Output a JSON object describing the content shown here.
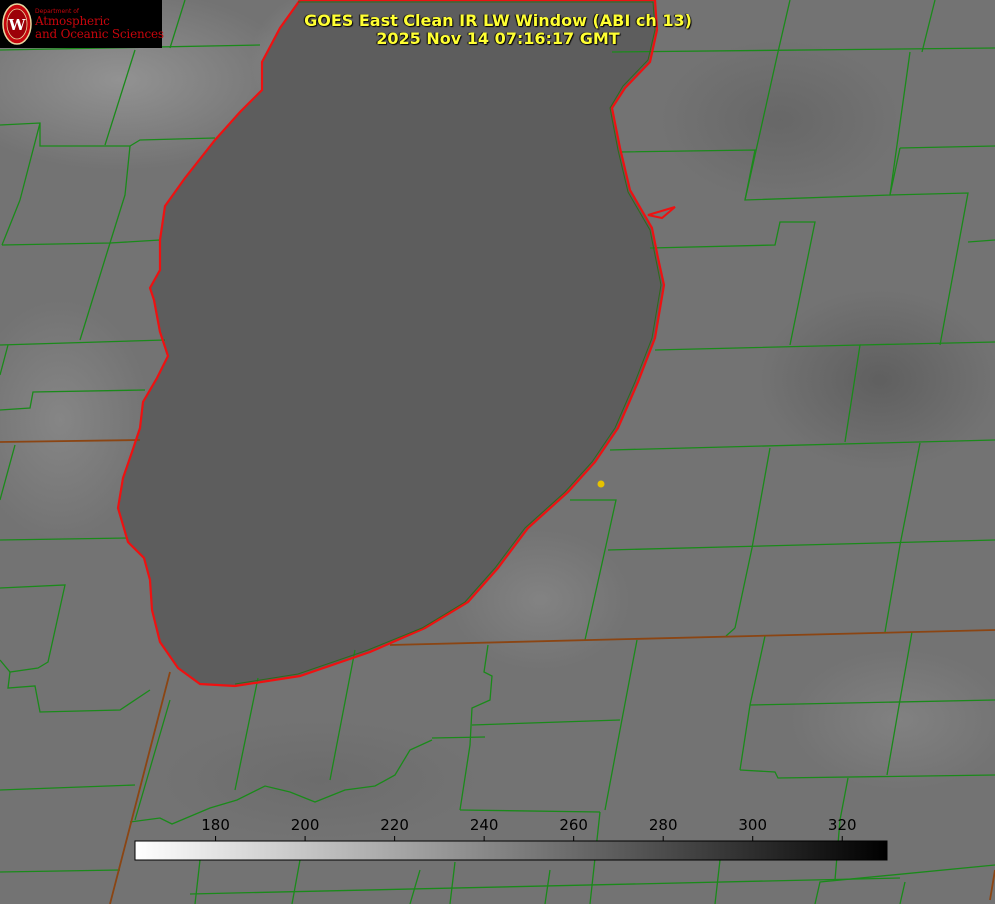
{
  "header": {
    "title": "GOES East Clean IR LW Window (ABI ch 13)",
    "timestamp": "2025 Nov 14 07:16:17 GMT"
  },
  "logo": {
    "department_line": "Department of",
    "name_line1": "Atmospheric",
    "name_line2": "and Oceanic Sciences",
    "seal_letter": "W"
  },
  "colorbar": {
    "ticks": [
      "180",
      "200",
      "220",
      "240",
      "260",
      "280",
      "300",
      "320"
    ],
    "tick_values": [
      180,
      200,
      220,
      240,
      260,
      280,
      300,
      320
    ],
    "range": [
      162,
      330
    ],
    "gradient": "white-to-black"
  },
  "colors": {
    "county_lines": "#1a8a1a",
    "state_lines": "#8b4513",
    "lake_shoreline": "#ee1111",
    "title_text": "#ffff33",
    "marker": "#e6c200"
  },
  "marker": {
    "name": "station-marker"
  }
}
